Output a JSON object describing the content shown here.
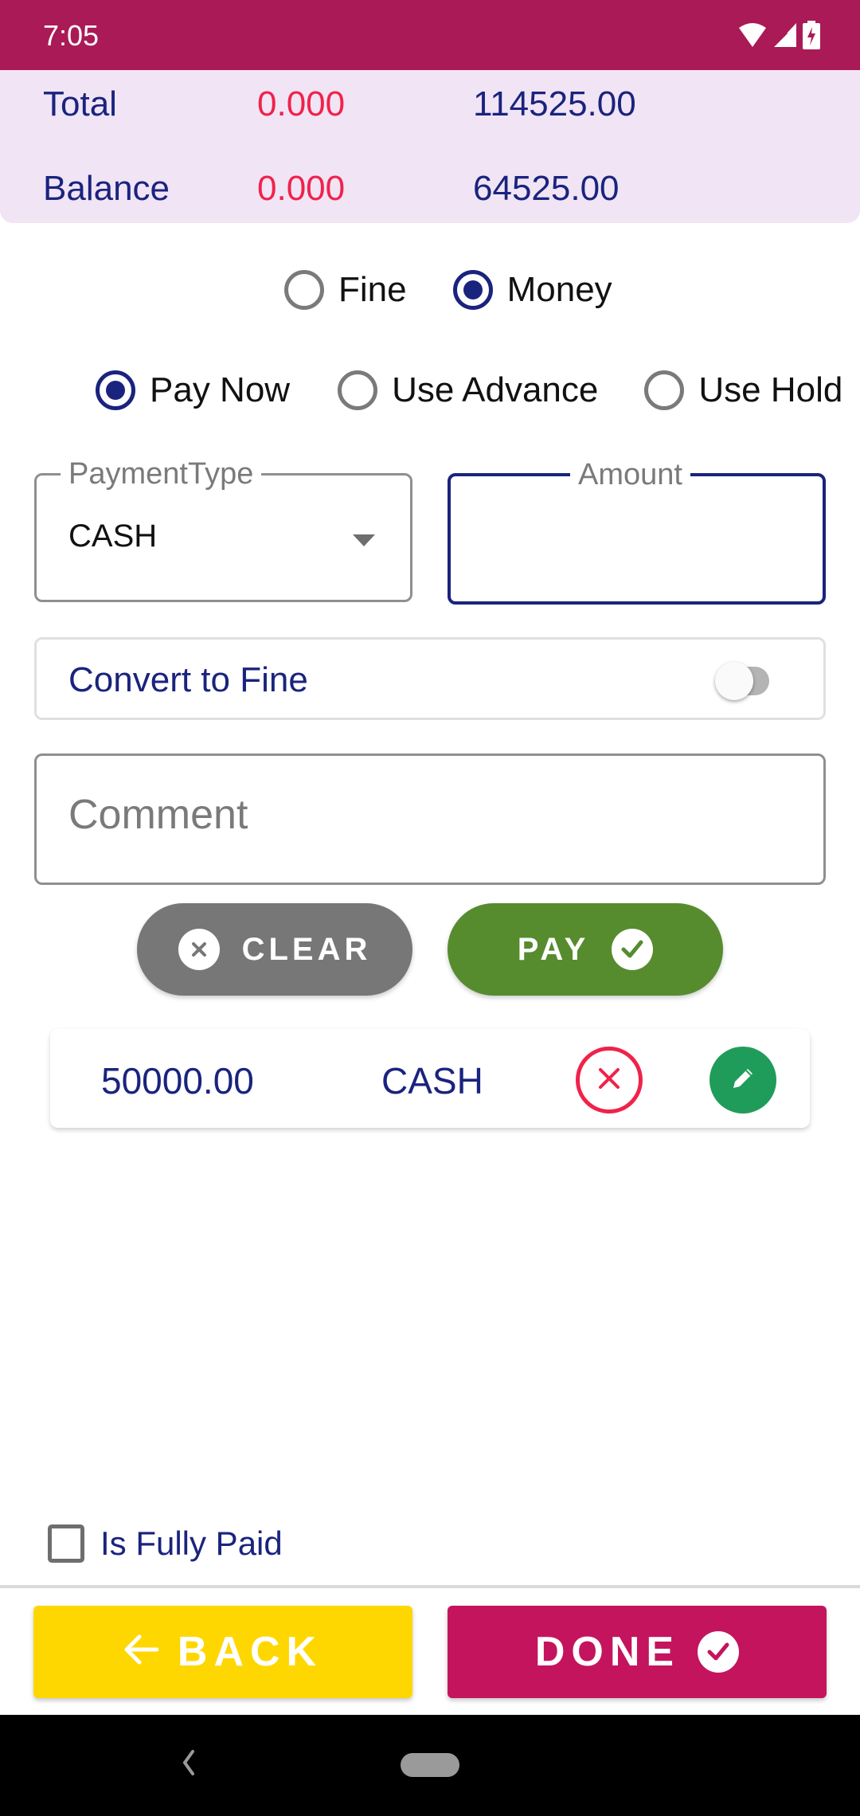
{
  "status_bar": {
    "time": "7:05",
    "icons": [
      "wifi-icon",
      "signal-icon",
      "battery-charging-icon"
    ]
  },
  "summary": {
    "rows": [
      {
        "label": "Total",
        "fine": "0.000",
        "amount": "114525.00"
      },
      {
        "label": "Balance",
        "fine": "0.000",
        "amount": "64525.00"
      }
    ],
    "colors": {
      "label": "#1A237E",
      "fine": "#F0224B",
      "amount": "#1A237E"
    }
  },
  "mode_radio": {
    "options": [
      {
        "label": "Fine",
        "checked": false
      },
      {
        "label": "Money",
        "checked": true
      }
    ]
  },
  "source_radio": {
    "options": [
      {
        "label": "Pay Now",
        "checked": true
      },
      {
        "label": "Use Advance",
        "checked": false
      },
      {
        "label": "Use Hold",
        "checked": false
      }
    ]
  },
  "payment_type": {
    "label": "PaymentType",
    "value": "CASH",
    "icon": "dropdown-arrow-icon"
  },
  "amount": {
    "label": "Amount",
    "value": ""
  },
  "convert_to_fine": {
    "label": "Convert to Fine",
    "enabled": false
  },
  "comment": {
    "placeholder": "Comment",
    "value": ""
  },
  "actions": {
    "clear_label": "CLEAR",
    "clear_icon": "close-circle-icon",
    "pay_label": "PAY",
    "pay_icon": "check-circle-icon"
  },
  "payments": [
    {
      "amount": "50000.00",
      "type": "CASH",
      "delete_icon": "close-circle-icon",
      "edit_icon": "pencil-icon"
    }
  ],
  "fully_paid": {
    "label": "Is Fully Paid",
    "checked": false
  },
  "footer": {
    "back_label": "BACK",
    "back_icon": "arrow-left-icon",
    "done_label": "DONE",
    "done_icon": "check-circle-icon"
  },
  "colors": {
    "status_bar": "#AA1A56",
    "summary_bg": "#F1E4F5",
    "primary": "#1A237E",
    "accent_red": "#F0224B",
    "clear": "#777777",
    "pay": "#568C2E",
    "edit": "#209C5A",
    "back": "#FED700",
    "done": "#C4145E"
  }
}
